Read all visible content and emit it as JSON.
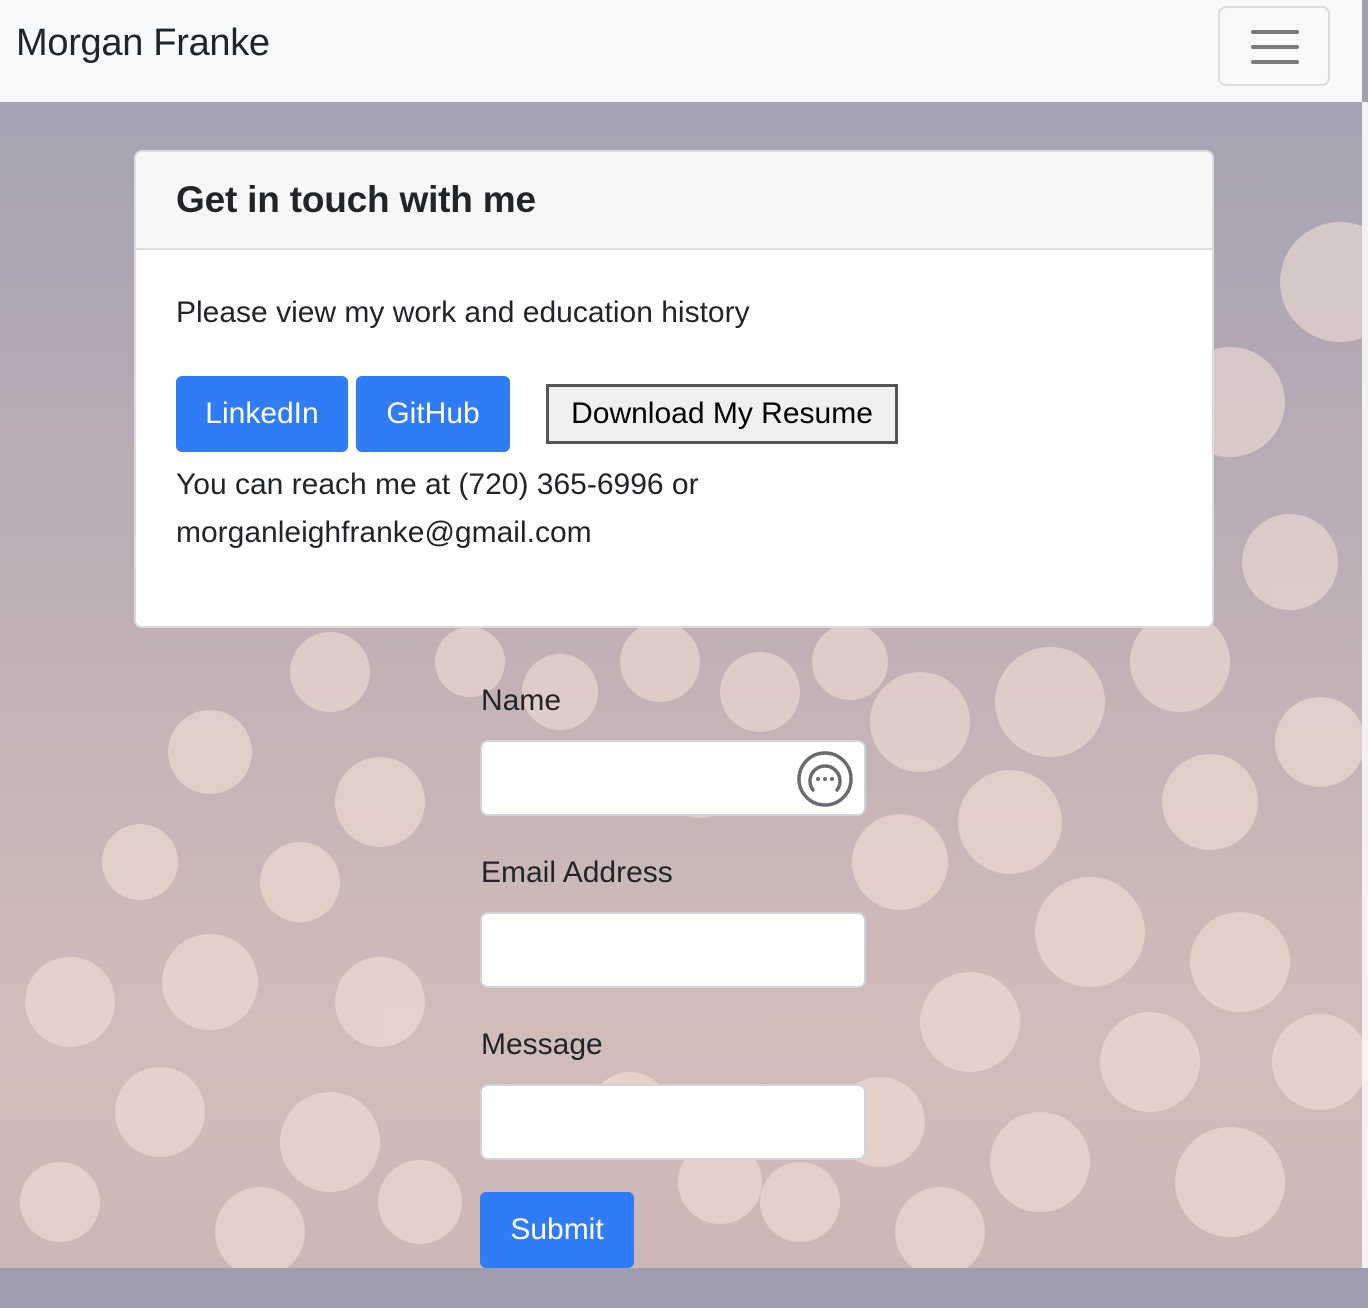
{
  "navbar": {
    "brand": "Morgan Franke",
    "toggler_icon": "hamburger-menu-icon"
  },
  "card": {
    "title": "Get in touch with me",
    "intro": "Please view my work and education history",
    "buttons": {
      "linkedin": "LinkedIn",
      "github": "GitHub",
      "resume": "Download My Resume"
    },
    "contact_line1": "You can reach me at (720) 365-6996 or",
    "contact_line2": "morganleighfranke@gmail.com"
  },
  "form": {
    "name_label": "Name",
    "name_value": "",
    "email_label": "Email Address",
    "email_value": "",
    "message_label": "Message",
    "message_value": "",
    "submit_label": "Submit",
    "password_manager_icon": "password-manager-icon"
  },
  "colors": {
    "primary": "#2f7cf6",
    "navbar_bg": "#f8f9fa",
    "card_header_bg": "#f7f7f7"
  }
}
